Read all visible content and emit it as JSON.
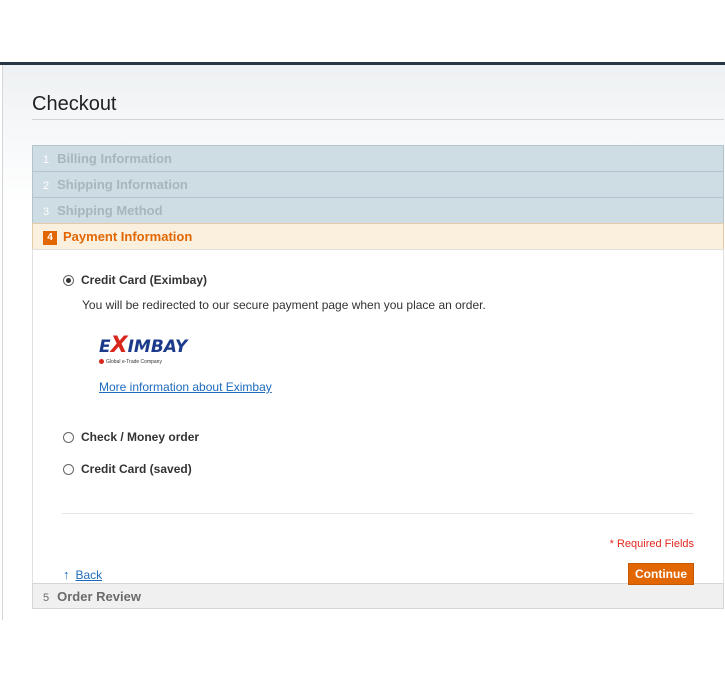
{
  "page": {
    "title": "Checkout"
  },
  "steps": [
    {
      "num": "1",
      "label": "Billing Information"
    },
    {
      "num": "2",
      "label": "Shipping Information"
    },
    {
      "num": "3",
      "label": "Shipping Method"
    },
    {
      "num": "4",
      "label": "Payment Information"
    },
    {
      "num": "5",
      "label": "Order Review"
    }
  ],
  "payment": {
    "options": [
      {
        "label": "Credit Card (Eximbay)",
        "selected": true
      },
      {
        "label": "Check / Money order",
        "selected": false
      },
      {
        "label": "Credit Card (saved)",
        "selected": false
      }
    ],
    "redirect_note": "You will be redirected to our secure payment page when you place an order.",
    "logo": {
      "main_prefix": "E",
      "main_x": "X",
      "main_suffix": "IMBAY",
      "tagline": "Global e-Trade Company"
    },
    "more_info_link": "More information about Eximbay",
    "required_fields": "* Required Fields",
    "back_arrow": "↑",
    "back_label": "Back",
    "continue_label": "Continue"
  }
}
